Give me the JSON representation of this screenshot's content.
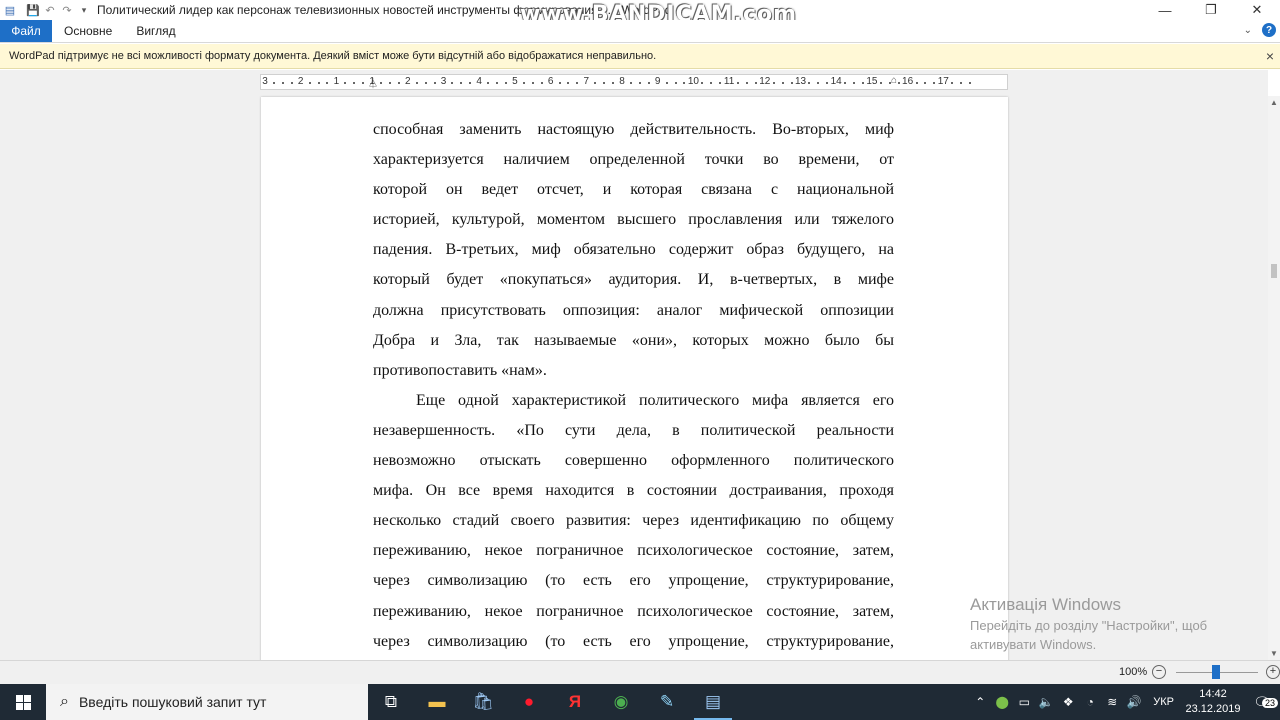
{
  "window": {
    "title": "Политический лидер как персонаж телевизионных новостей инструменты формирования ... - WordPad",
    "overlay_watermark": "www.BANDICAM.com",
    "controls": {
      "minimize": "—",
      "maximize": "❐",
      "close": "✕"
    }
  },
  "ribbon": {
    "tabs": [
      "Файл",
      "Основне",
      "Вигляд"
    ],
    "expand_glyph": "⌄",
    "help_glyph": "?"
  },
  "infobar": {
    "message": "WordPad підтримує не всі можливості формату документа. Деякий вміст може бути відсутній або відображатися неправильно.",
    "close_glyph": "×"
  },
  "ruler": {
    "labels": [
      "3",
      "2",
      "1",
      "1",
      "2",
      "3",
      "4",
      "5",
      "6",
      "7",
      "8",
      "9",
      "10",
      "11",
      "12",
      "13",
      "14",
      "15",
      "16",
      "17"
    ]
  },
  "document": {
    "paragraph1": [
      "способная заменить настоящую действительность. Во-вторых, миф",
      "характеризуется наличием определенной точки во времени, от",
      "которой он ведет отсчет, и которая связана с национальной",
      "историей, культурой, моментом высшего прославления или тяжелого",
      "падения. В-третьих, миф обязательно содержит образ будущего, на",
      "который будет «покупаться» аудитория. И, в-четвертых, в мифе",
      "должна присутствовать оппозиция: аналог мифической оппозиции",
      "Добра и Зла, так называемые «они», которых можно было бы",
      "противопоставить «нам»."
    ],
    "paragraph2": [
      "Еще одной характеристикой политического мифа является его",
      "незавершенность. «По сути дела, в политической реальности",
      "невозможно отыскать совершенно оформленного политического",
      "мифа. Он все время находится в состоянии достраивания, проходя",
      "несколько стадий своего развития: через идентификацию по общему",
      "переживанию, некое пограничное психологическое состояние, затем,",
      "через символизацию (то есть его упрощение, структурирование,",
      "переживанию, некое пограничное психологическое состояние, затем,",
      "через символизацию (то есть его упрощение, структурирование,"
    ]
  },
  "statusbar": {
    "zoom": "100%",
    "zoom_minus": "−",
    "zoom_plus": "+",
    "zoom_level_percent": 100
  },
  "activation": {
    "title": "Активація Windows",
    "line1": "Перейдіть до розділу \"Настройки\", щоб",
    "line2": "активувати Windows."
  },
  "taskbar": {
    "search_placeholder": "Введіть пошуковий запит тут",
    "language": "УКР",
    "time": "14:42",
    "date": "23.12.2019",
    "notifications": "23"
  }
}
